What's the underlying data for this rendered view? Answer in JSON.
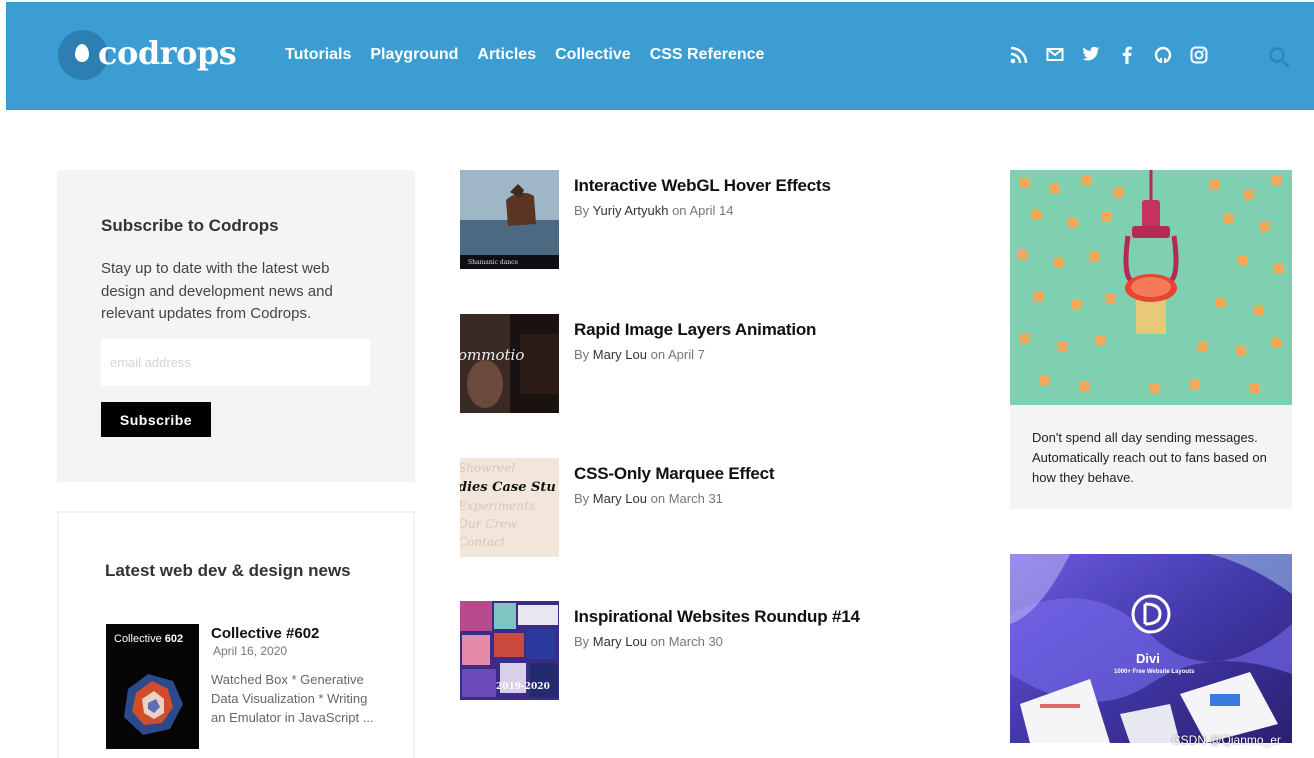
{
  "header": {
    "logo_text": "codrops",
    "nav": [
      "Tutorials",
      "Playground",
      "Articles",
      "Collective",
      "CSS Reference"
    ],
    "social_icons": [
      "rss-icon",
      "mail-icon",
      "twitter-icon",
      "facebook-icon",
      "github-icon",
      "instagram-icon"
    ],
    "search_icon": "search-icon",
    "bg_color": "#3b9dd2"
  },
  "subscribe": {
    "title": "Subscribe to Codrops",
    "description": "Stay up to date with the latest web design and development news and relevant updates from Codrops.",
    "placeholder": "email address",
    "button_label": "Subscribe"
  },
  "news": {
    "title": "Latest web dev & design news",
    "thumb_label": "Collective",
    "thumb_number": "602",
    "item_title": "Collective #602",
    "item_date": "April 16, 2020",
    "item_desc": "Watched Box * Generative Data Visualization * Writing an Emulator in JavaScript ..."
  },
  "articles": [
    {
      "title": "Interactive WebGL Hover Effects",
      "by": "By",
      "author": "Yuriy Artyukh",
      "on": "on",
      "date": "April 14",
      "thumb_caption": "Shamanic dance"
    },
    {
      "title": "Rapid Image Layers Animation",
      "by": "By",
      "author": "Mary Lou",
      "on": "on",
      "date": "April 7",
      "thumb_caption": "ommotio"
    },
    {
      "title": "CSS-Only Marquee Effect",
      "by": "By",
      "author": "Mary Lou",
      "on": "on",
      "date": "March 31",
      "thumb_lines": [
        "Showreel",
        "dies Case Stu",
        "Experiments",
        "Our Crew",
        "Contact"
      ]
    },
    {
      "title": "Inspirational Websites Roundup #14",
      "by": "By",
      "author": "Mary Lou",
      "on": "on",
      "date": "March 30",
      "thumb_caption": "2019-2020"
    }
  ],
  "ads": {
    "ad1_text": "Don't spend all day sending messages. Automatically reach out to fans based on how they behave.",
    "ad2_brand": "Divi",
    "ad2_tagline": "1000+ Free Website Layouts"
  },
  "watermark": "CSDN @Qianmo_er"
}
